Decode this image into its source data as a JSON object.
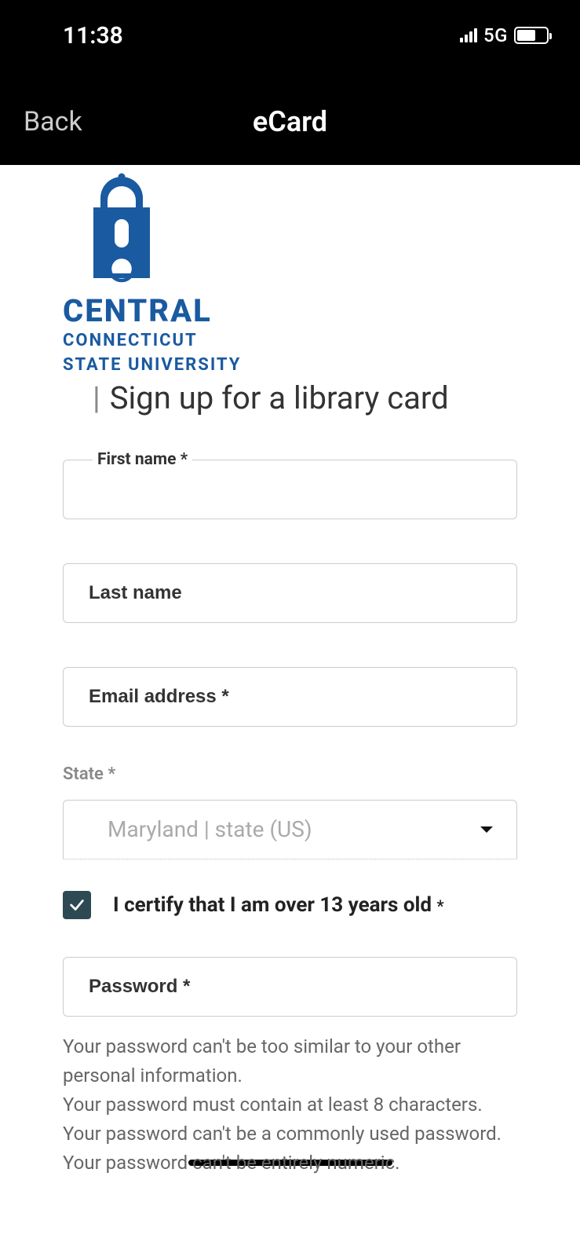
{
  "status": {
    "time": "11:38",
    "network": "5G"
  },
  "nav": {
    "back": "Back",
    "title": "eCard"
  },
  "logo": {
    "main": "CENTRAL",
    "line1": "CONNECTICUT",
    "line2": "STATE UNIVERSITY"
  },
  "page": {
    "title": "Sign up for a library card"
  },
  "form": {
    "first_name_label": "First name *",
    "last_name_placeholder": "Last name",
    "email_placeholder": "Email address *",
    "state_label": "State *",
    "state_placeholder": "Maryland | state (US)",
    "certify_label": "I certify that I am over 13 years old ",
    "certify_ast": "*",
    "certify_checked": true,
    "password_placeholder": "Password *",
    "pw_hint1": "Your password can't be too similar to your other personal information.",
    "pw_hint2": "Your password must contain at least 8 characters.",
    "pw_hint3": "Your password can't be a commonly used password.",
    "pw_hint4": "Your password can't be entirely numeric."
  }
}
